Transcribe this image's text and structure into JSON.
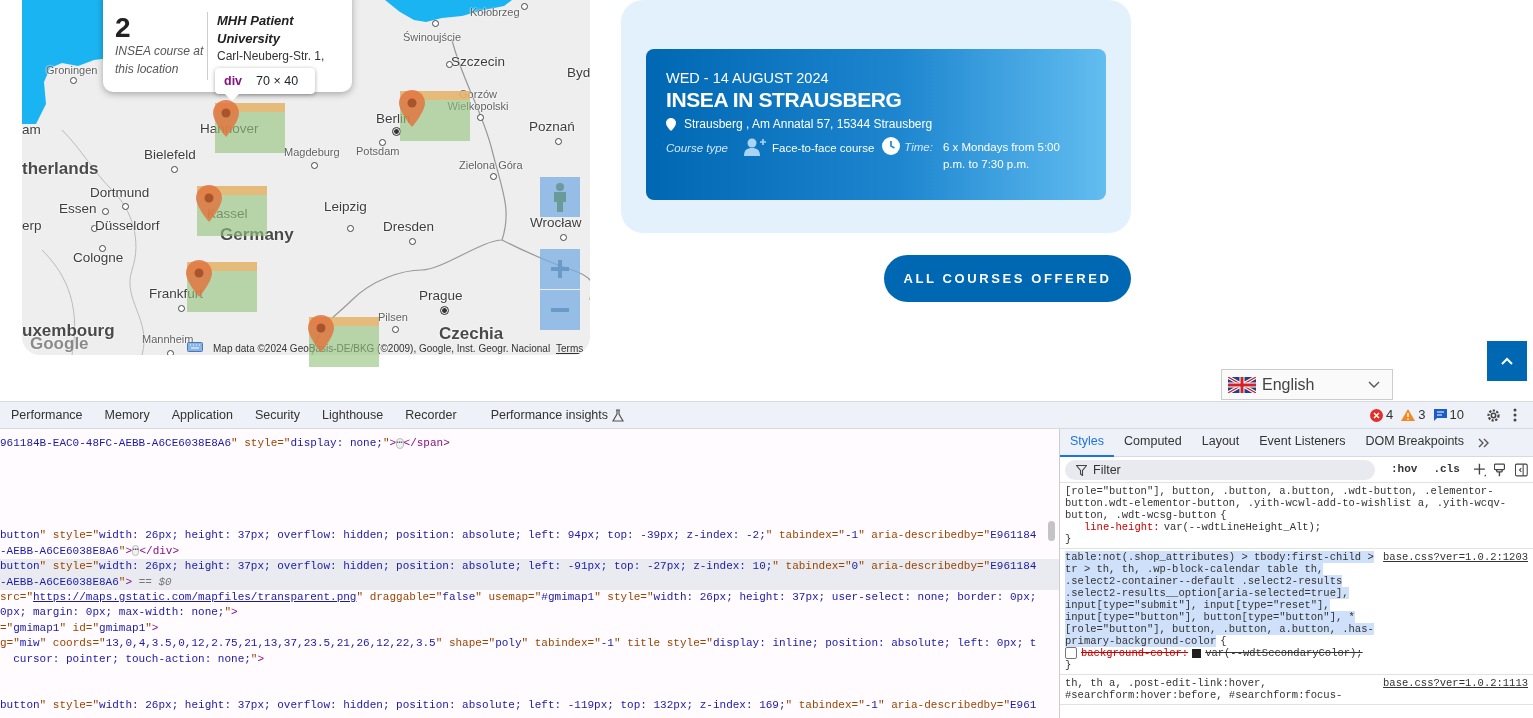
{
  "map": {
    "labels": [
      {
        "text": "Groningen",
        "kind": "town"
      },
      {
        "text": "Kołobrzeg",
        "kind": "town"
      },
      {
        "text": "Świnoujście",
        "kind": "town"
      },
      {
        "text": "Szczecin",
        "kind": "city"
      },
      {
        "text": "Byd",
        "kind": "city"
      },
      {
        "text": "am",
        "kind": "city"
      },
      {
        "text": "Hannover",
        "kind": "city"
      },
      {
        "text": "Gorzów Wielkopolski",
        "kind": "town"
      },
      {
        "text": "Berlin",
        "kind": "city"
      },
      {
        "text": "Poznań",
        "kind": "city"
      },
      {
        "text": "Bielefeld",
        "kind": "city"
      },
      {
        "text": "Magdeburg",
        "kind": "town"
      },
      {
        "text": "Potsdam",
        "kind": "town"
      },
      {
        "text": "therlands",
        "kind": "country"
      },
      {
        "text": "Zielona Góra",
        "kind": "town"
      },
      {
        "text": "Dortmund",
        "kind": "city"
      },
      {
        "text": "Essen",
        "kind": "city"
      },
      {
        "text": "Kassel",
        "kind": "city"
      },
      {
        "text": "Leipzig",
        "kind": "city"
      },
      {
        "text": "Wrocław",
        "kind": "city"
      },
      {
        "text": "erp",
        "kind": "city"
      },
      {
        "text": "Düsseldorf",
        "kind": "city"
      },
      {
        "text": "Germany",
        "kind": "country"
      },
      {
        "text": "Dresden",
        "kind": "city"
      },
      {
        "text": "Cologne",
        "kind": "city"
      },
      {
        "text": "Frankfurt",
        "kind": "city"
      },
      {
        "text": "Prague",
        "kind": "city"
      },
      {
        "text": "Pilsen",
        "kind": "town"
      },
      {
        "text": "uxembourg",
        "kind": "country"
      },
      {
        "text": "Czechia",
        "kind": "country"
      },
      {
        "text": "Mannheim",
        "kind": "town"
      }
    ],
    "popup": {
      "count": "2",
      "caption": "INSEA course at this location",
      "venue": "MHH Patient University",
      "address": "Carl-Neuberg-Str. 1,"
    },
    "inspect_tooltip": {
      "tag": "div",
      "size": "70 × 40"
    },
    "logo": "Google",
    "attribution": "Map data ©2024 GeoBasis-DE/BKG (©2009), Google, Inst. Geogr. Nacional",
    "terms": "Terms"
  },
  "course": {
    "date": "WED - 14 AUGUST 2024",
    "title": "INSEA IN STRAUSBERG",
    "address": "Strausberg , Am Annatal 57, 15344 Strausberg",
    "type_label": "Course type",
    "type": "Face-to-face course",
    "time_label": "Time:",
    "time": "6 x Mondays from 5:00 p.m. to 7:30 p.m."
  },
  "all_courses_button": "ALL COURSES OFFERED",
  "language": {
    "value": "English"
  },
  "devtools": {
    "tabs": [
      {
        "label": "Performance",
        "selected": false
      },
      {
        "label": "Memory",
        "selected": false
      },
      {
        "label": "Application",
        "selected": false
      },
      {
        "label": "Security",
        "selected": false
      },
      {
        "label": "Lighthouse",
        "selected": false
      },
      {
        "label": "Recorder",
        "selected": false
      },
      {
        "label": "Performance insights",
        "selected": false,
        "experimental": true
      }
    ],
    "errors": "4",
    "warnings": "3",
    "messages": "10",
    "dom_lines": [
      {
        "selected": false,
        "segments": [
          {
            "kind": "val",
            "text": "961184B-EAC0-48FC-AEBB-A6CE6038E8A6"
          },
          {
            "kind": "attr",
            "text": "\" style=\""
          },
          {
            "kind": "val",
            "text": "display: none;"
          },
          {
            "kind": "attr",
            "text": "\""
          },
          {
            "kind": "tag",
            "text": ">"
          },
          {
            "kind": "ell",
            "text": "⋯"
          },
          {
            "kind": "tag",
            "text": "</span>"
          }
        ]
      },
      {
        "selected": false,
        "segments": [
          {
            "kind": "val",
            "text": "button"
          },
          {
            "kind": "attr",
            "text": "\" style=\""
          },
          {
            "kind": "val",
            "text": "width: 26px; height: 37px; overflow: hidden; position: absolute; left: 94px; top: -39px; z-index: -2;"
          },
          {
            "kind": "attr",
            "text": "\" tabindex=\""
          },
          {
            "kind": "val",
            "text": "-1"
          },
          {
            "kind": "attr",
            "text": "\" aria-describedby=\""
          },
          {
            "kind": "val",
            "text": "E961184"
          }
        ]
      },
      {
        "selected": false,
        "segments": [
          {
            "kind": "val",
            "text": "-AEBB-A6CE6038E8A6"
          },
          {
            "kind": "attr",
            "text": "\""
          },
          {
            "kind": "tag",
            "text": ">"
          },
          {
            "kind": "ell",
            "text": "⋯"
          },
          {
            "kind": "tag",
            "text": "</div>"
          }
        ]
      },
      {
        "selected": true,
        "segments": [
          {
            "kind": "val",
            "text": "button"
          },
          {
            "kind": "attr",
            "text": "\" style=\""
          },
          {
            "kind": "val",
            "text": "width: 26px; height: 37px; overflow: hidden; position: absolute; left: -91px; top: -27px; z-index: 10;"
          },
          {
            "kind": "attr",
            "text": "\" tabindex=\""
          },
          {
            "kind": "val",
            "text": "0"
          },
          {
            "kind": "attr",
            "text": "\" aria-describedby=\""
          },
          {
            "kind": "val",
            "text": "E961184"
          }
        ]
      },
      {
        "selected": true,
        "segments": [
          {
            "kind": "val",
            "text": "-AEBB-A6CE6038E8A6"
          },
          {
            "kind": "attr",
            "text": "\""
          },
          {
            "kind": "tag",
            "text": ">"
          },
          {
            "kind": "muted",
            "text": " == $0"
          }
        ]
      },
      {
        "selected": false,
        "segments": [
          {
            "kind": "attr",
            "text": "src=\""
          },
          {
            "kind": "link",
            "text": "https://maps.gstatic.com/mapfiles/transparent.png"
          },
          {
            "kind": "attr",
            "text": "\" draggable=\""
          },
          {
            "kind": "val",
            "text": "false"
          },
          {
            "kind": "attr",
            "text": "\" usemap=\""
          },
          {
            "kind": "val",
            "text": "#gmimap1"
          },
          {
            "kind": "attr",
            "text": "\" style=\""
          },
          {
            "kind": "val",
            "text": "width: 26px; height: 37px; user-select: none; border: 0px;"
          }
        ]
      },
      {
        "selected": false,
        "segments": [
          {
            "kind": "val",
            "text": "0px; margin: 0px; max-width: none;"
          },
          {
            "kind": "attr",
            "text": "\""
          },
          {
            "kind": "tag",
            "text": ">"
          }
        ]
      },
      {
        "selected": false,
        "segments": [
          {
            "kind": "attr",
            "text": "=\""
          },
          {
            "kind": "val",
            "text": "gmimap1"
          },
          {
            "kind": "attr",
            "text": "\" id=\""
          },
          {
            "kind": "val",
            "text": "gmimap1"
          },
          {
            "kind": "attr",
            "text": "\""
          },
          {
            "kind": "tag",
            "text": ">"
          }
        ]
      },
      {
        "selected": false,
        "segments": [
          {
            "kind": "attr",
            "text": "g=\""
          },
          {
            "kind": "val",
            "text": "miw"
          },
          {
            "kind": "attr",
            "text": "\" coords=\""
          },
          {
            "kind": "val",
            "text": "13,0,4,3.5,0,12,2.75,21,13,37,23.5,21,26,12,22,3.5"
          },
          {
            "kind": "attr",
            "text": "\" shape=\""
          },
          {
            "kind": "val",
            "text": "poly"
          },
          {
            "kind": "attr",
            "text": "\" tabindex=\""
          },
          {
            "kind": "val",
            "text": "-1"
          },
          {
            "kind": "attr",
            "text": "\" title style=\""
          },
          {
            "kind": "val",
            "text": "display: inline; position: absolute; left: 0px; t"
          }
        ]
      },
      {
        "selected": false,
        "segments": [
          {
            "kind": "val",
            "text": "  cursor: pointer; touch-action: none;"
          },
          {
            "kind": "attr",
            "text": "\""
          },
          {
            "kind": "tag",
            "text": ">"
          }
        ]
      },
      {
        "selected": false,
        "segments": [
          {
            "kind": "val",
            "text": "button"
          },
          {
            "kind": "attr",
            "text": "\" style=\""
          },
          {
            "kind": "val",
            "text": "width: 26px; height: 37px; overflow: hidden; position: absolute; left: -119px; top: 132px; z-index: 169;"
          },
          {
            "kind": "attr",
            "text": "\" tabindex=\""
          },
          {
            "kind": "val",
            "text": "-1"
          },
          {
            "kind": "attr",
            "text": "\" aria-describedby=\""
          },
          {
            "kind": "val",
            "text": "E961"
          }
        ]
      }
    ],
    "sidebar_tabs": [
      {
        "label": "Styles",
        "selected": true
      },
      {
        "label": "Computed",
        "selected": false
      },
      {
        "label": "Layout",
        "selected": false
      },
      {
        "label": "Event Listeners",
        "selected": false
      },
      {
        "label": "DOM Breakpoints",
        "selected": false
      }
    ],
    "filter": {
      "placeholder": "Filter"
    },
    "hov": ":hov",
    "cls": ".cls",
    "rules": [
      {
        "selector": "[role=\"button\"], button, .button, a.button, .wdt-button, .elementor-button.wdt-elementor-button, .yith-wcwl-add-to-wishlist a, .yith-wcqv-button, .wdt-wcsg-button",
        "selected": false,
        "brace_open": "{",
        "brace_close": "}",
        "properties": [
          {
            "name": "line-height:",
            "value": "var(--wdtLineHeight_Alt);",
            "enabled": true,
            "overridden": false
          }
        ]
      },
      {
        "selector": "table:not(.shop_attributes) > tbody:first-child > tr > th, th, .wp-block-calendar table th, .select2-container--default .select2-results .select2-results__option[aria-selected=true], input[type=\"submit\"], input[type=\"reset\"], input[type=\"button\"], button[type=\"button\"], *[role=\"button\"], button, .button, a.button, .has-primary-background-color",
        "selected": true,
        "source": "base.css?ver=1.0.2:1203",
        "brace_open": "{",
        "brace_close": "}",
        "properties": [
          {
            "name": "background-color:",
            "value": "var(--wdtSecondaryColor);",
            "enabled": false,
            "overridden": true
          }
        ]
      },
      {
        "selector": "th, th a, .post-edit-link:hover, #searchform:hover:before, #searchform:focus-",
        "selected": false,
        "source": "base.css?ver=1.0.2:1113"
      }
    ]
  }
}
